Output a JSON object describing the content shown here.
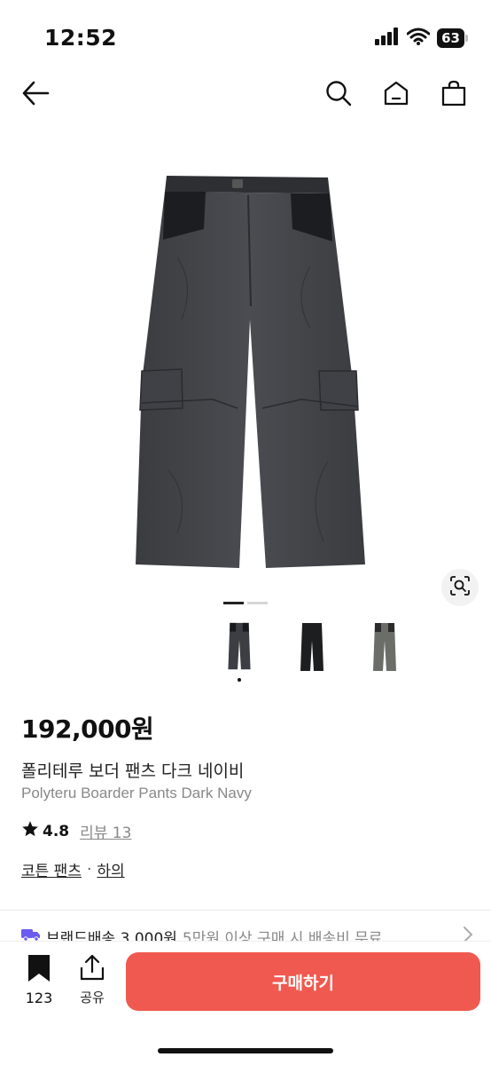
{
  "status_bar": {
    "time": "12:52",
    "battery": "63"
  },
  "colors": {
    "accent": "#f0594f",
    "shipping_badge": "#6b5cf0"
  },
  "icons": {
    "back": "back-arrow-icon",
    "search": "search-icon",
    "home": "home-icon",
    "cart": "shopping-bag-icon",
    "lens": "image-search-icon",
    "star": "star-icon",
    "shipping": "truck-icon",
    "chevron": "chevron-right-icon",
    "bookmark": "bookmark-icon",
    "share": "share-icon"
  },
  "gallery": {
    "page_count": 2,
    "active_page": 1
  },
  "product": {
    "price": "192,000원",
    "name_ko": "폴리테루 보더 팬츠 다크 네이비",
    "name_en": "Polyteru Boarder Pants Dark Navy",
    "rating": "4.8",
    "review_label": "리뷰 13",
    "category_main": "코튼 팬츠",
    "category_separator": "·",
    "category_sub": "하의"
  },
  "shipping": {
    "label": "브랜드배송 3,000원",
    "condition": "5만원 이상 구매 시 배송비 무료"
  },
  "bottom_bar": {
    "bookmark_count": "123",
    "share_label": "공유",
    "buy_label": "구매하기"
  }
}
